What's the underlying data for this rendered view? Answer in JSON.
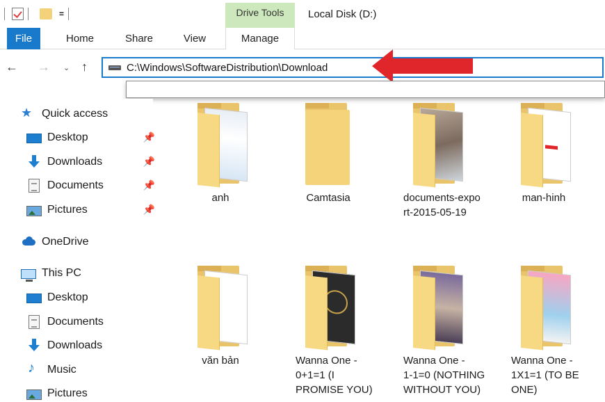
{
  "titlebar": {
    "qat_dropdown": "=",
    "context_tab": "Drive Tools",
    "window_title": "Local Disk (D:)"
  },
  "ribbon": {
    "tabs": [
      "File",
      "Home",
      "Share",
      "View",
      "Manage"
    ]
  },
  "nav": {
    "back": "←",
    "forward": "→",
    "recent": "⌄",
    "up": "↑",
    "address": "C:\\Windows\\SoftwareDistribution\\Download"
  },
  "sidebar": {
    "quick_access": "Quick access",
    "qa_items": [
      "Desktop",
      "Downloads",
      "Documents",
      "Pictures"
    ],
    "onedrive": "OneDrive",
    "this_pc": "This PC",
    "pc_items": [
      "Desktop",
      "Documents",
      "Downloads",
      "Music",
      "Pictures"
    ],
    "pin_glyph": "📌"
  },
  "folders": [
    {
      "label": "anh",
      "thumb": "ui"
    },
    {
      "label": "Camtasia",
      "thumb": "none"
    },
    {
      "label": "documents-expo\nrt-2015-05-19",
      "thumb": "photo"
    },
    {
      "label": "man-hinh",
      "thumb": "redmark"
    },
    {
      "label": "văn bản",
      "thumb": "docs"
    },
    {
      "label": "Wanna One -\n0+1=1 (I\nPROMISE YOU)",
      "thumb": "dark"
    },
    {
      "label": "Wanna One -\n1-1=0 (NOTHING\nWITHOUT YOU)",
      "thumb": "group"
    },
    {
      "label": "Wanna One -\n1X1=1 (TO BE\nONE)",
      "thumb": "pink"
    }
  ],
  "colors": {
    "accent": "#1979ca",
    "context_tab_bg": "#cde8bc",
    "folder": "#f5d37b",
    "arrow": "#e0262a"
  }
}
